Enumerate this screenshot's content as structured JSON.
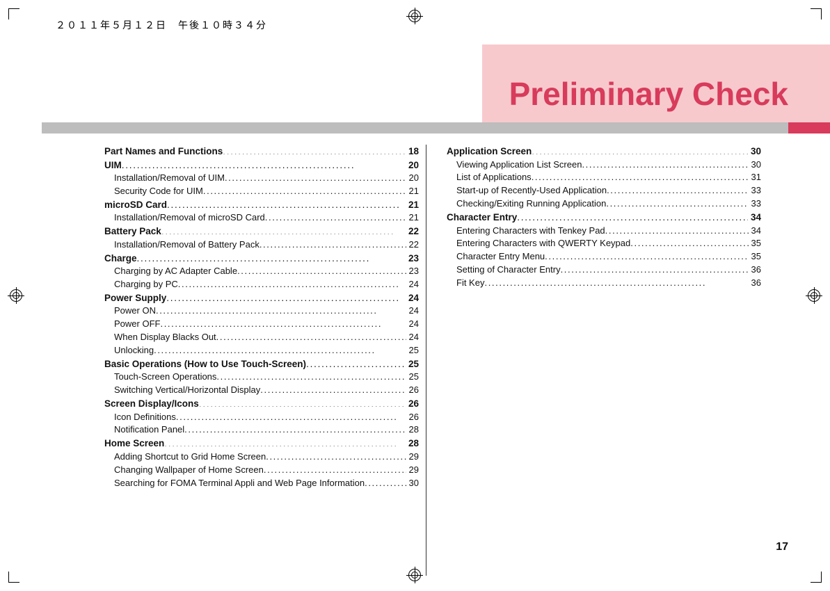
{
  "meta": {
    "datestamp": "２０１１年５月１２日　午後１０時３４分",
    "chapter_title": "Preliminary Check",
    "page_number": "17"
  },
  "colors": {
    "accent": "#d83b5b",
    "accent_light": "#f7c9cd",
    "bar_gray": "#bdbdbd"
  },
  "toc_left": [
    {
      "title": "Part Names and Functions",
      "page": "18",
      "subs": []
    },
    {
      "title": "UIM",
      "page": "20",
      "subs": [
        {
          "title": "Installation/Removal of UIM",
          "page": "20"
        },
        {
          "title": "Security Code for UIM",
          "page": "21"
        }
      ]
    },
    {
      "title": "microSD Card",
      "page": "21",
      "subs": [
        {
          "title": "Installation/Removal of microSD Card",
          "page": "21"
        }
      ]
    },
    {
      "title": "Battery Pack",
      "page": "22",
      "subs": [
        {
          "title": "Installation/Removal of Battery Pack",
          "page": "22"
        }
      ]
    },
    {
      "title": "Charge",
      "page": "23",
      "subs": [
        {
          "title": "Charging by AC Adapter Cable",
          "page": "23"
        },
        {
          "title": "Charging by PC",
          "page": "24"
        }
      ]
    },
    {
      "title": "Power Supply",
      "page": "24",
      "subs": [
        {
          "title": "Power ON",
          "page": "24"
        },
        {
          "title": "Power OFF",
          "page": "24"
        },
        {
          "title": "When Display Blacks Out",
          "page": "24"
        },
        {
          "title": "Unlocking",
          "page": "25"
        }
      ]
    },
    {
      "title": "Basic Operations (How to Use Touch-Screen)",
      "page": "25",
      "subs": [
        {
          "title": "Touch-Screen Operations",
          "page": "25"
        },
        {
          "title": "Switching Vertical/Horizontal Display",
          "page": "26"
        }
      ]
    },
    {
      "title": "Screen Display/Icons",
      "page": "26",
      "subs": [
        {
          "title": "Icon Definitions",
          "page": "26"
        },
        {
          "title": "Notification Panel",
          "page": "28"
        }
      ]
    },
    {
      "title": "Home Screen",
      "page": "28",
      "subs": [
        {
          "title": "Adding Shortcut to Grid Home Screen",
          "page": "29"
        },
        {
          "title": "Changing Wallpaper of Home Screen",
          "page": "29"
        },
        {
          "title": "Searching for FOMA Terminal Appli and Web Page Information",
          "page": "30"
        }
      ]
    }
  ],
  "toc_right": [
    {
      "title": "Application Screen",
      "page": "30",
      "subs": [
        {
          "title": "Viewing Application List Screen",
          "page": "30"
        },
        {
          "title": "List of Applications",
          "page": "31"
        },
        {
          "title": "Start-up of Recently-Used Application",
          "page": "33"
        },
        {
          "title": "Checking/Exiting Running Application",
          "page": "33"
        }
      ]
    },
    {
      "title": "Character Entry",
      "page": "34",
      "subs": [
        {
          "title": "Entering Characters with Tenkey Pad",
          "page": "34"
        },
        {
          "title": "Entering Characters with QWERTY Keypad",
          "page": "35"
        },
        {
          "title": "Character Entry Menu",
          "page": "35"
        },
        {
          "title": "Setting of Character Entry",
          "page": "36"
        },
        {
          "title": "Fit Key",
          "page": "36"
        }
      ]
    }
  ]
}
